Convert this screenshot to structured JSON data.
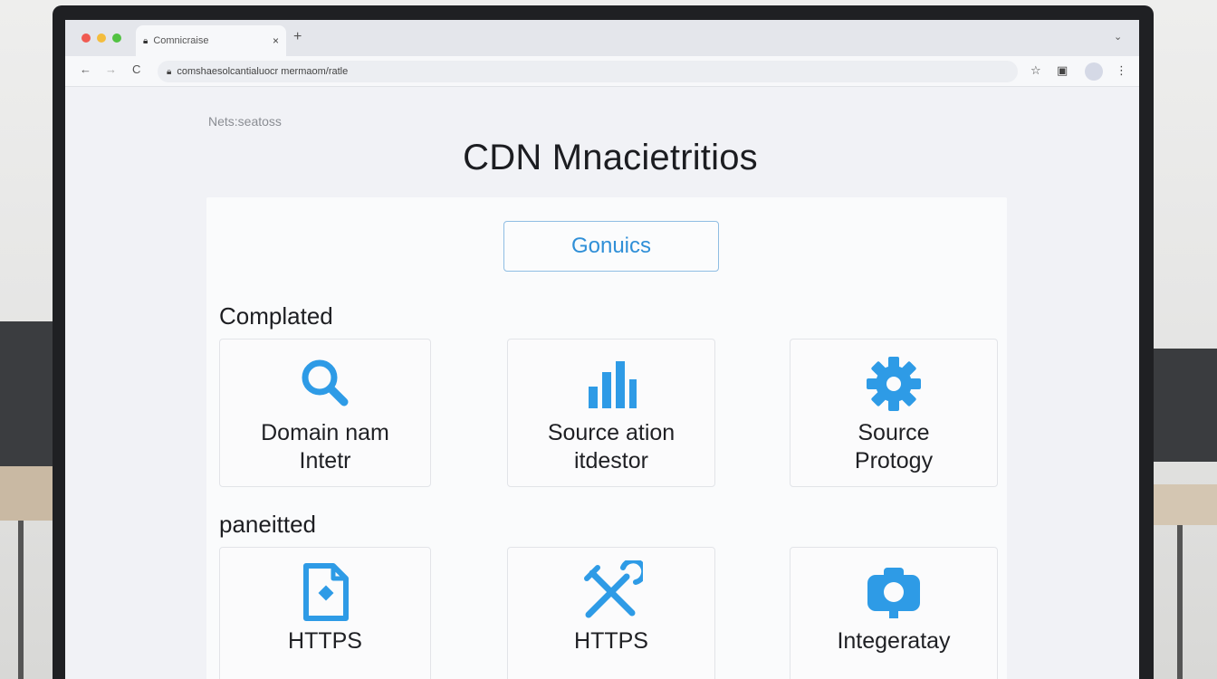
{
  "browser": {
    "tab_title": "Comnicraise",
    "tab_close": "×",
    "new_tab": "+",
    "chevron": "⌄",
    "url": "comshaesolcantialuocr mermaom/ratle",
    "back": "←",
    "forward": "→",
    "reload": "C",
    "star": "☆",
    "reader": "▣",
    "menu": "⋮"
  },
  "page": {
    "breadcrumb": "Nets:seatoss",
    "title": "CDN Mnacietritios",
    "primary_button": "Gonuics"
  },
  "sections": [
    {
      "label": "Complated",
      "cards": [
        {
          "label": "Domain nam\nIntetr",
          "icon": "search-icon"
        },
        {
          "label": "Source ation\nitdestor",
          "icon": "bar-chart-icon"
        },
        {
          "label": "Source\nProtogy",
          "icon": "gear-icon"
        }
      ]
    },
    {
      "label": "paneitted",
      "cards": [
        {
          "label": "HTTPS",
          "icon": "document-icon"
        },
        {
          "label": "HTTPS",
          "icon": "tools-icon"
        },
        {
          "label": "Integeratay",
          "icon": "camera-icon"
        }
      ]
    }
  ],
  "colors": {
    "accent": "#2f8fd7",
    "icon_blue": "#2e9be6"
  }
}
